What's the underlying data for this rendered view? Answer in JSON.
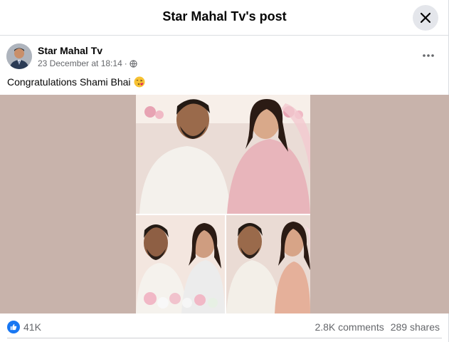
{
  "modal": {
    "title": "Star Mahal Tv's post"
  },
  "post": {
    "author": "Star Mahal Tv",
    "timestamp": "23 December at 18:14",
    "separator": "·",
    "audience_icon": "globe-icon",
    "caption": "Congratulations Shami Bhai",
    "caption_emoji": "face-blowing-kiss-emoji"
  },
  "engagement": {
    "reaction_icon": "like-icon",
    "reactions_count": "41K",
    "comments": "2.8K comments",
    "shares": "289 shares"
  },
  "colors": {
    "brand_blue": "#1877f2",
    "secondary_text": "#65676b",
    "photo_background": "#c8b3ab",
    "close_button_bg": "#e4e6eb"
  }
}
